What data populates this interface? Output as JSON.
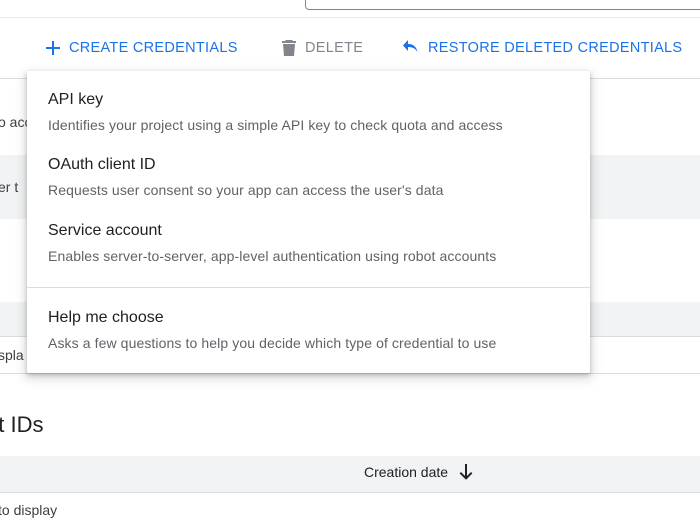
{
  "toolbar": {
    "create_label": "CREATE CREDENTIALS",
    "delete_label": "DELETE",
    "restore_label": "RESTORE DELETED CREDENTIALS"
  },
  "background": {
    "frag_1": "o acc",
    "frag_2": "er t",
    "frag_3": "spla",
    "section_title": "nt IDs",
    "column_header": "Creation date",
    "empty_text": "to display"
  },
  "menu": {
    "items": [
      {
        "title": "API key",
        "description": "Identifies your project using a simple API key to check quota and access"
      },
      {
        "title": "OAuth client ID",
        "description": "Requests user consent so your app can access the user's data"
      },
      {
        "title": "Service account",
        "description": "Enables server-to-server, app-level authentication using robot accounts"
      },
      {
        "title": "Help me choose",
        "description": "Asks a few questions to help you decide which type of credential to use"
      }
    ]
  },
  "colors": {
    "accent": "#1a73e8",
    "disabled": "#80868b",
    "text": "#202124",
    "secondary_text": "#5f6368"
  }
}
